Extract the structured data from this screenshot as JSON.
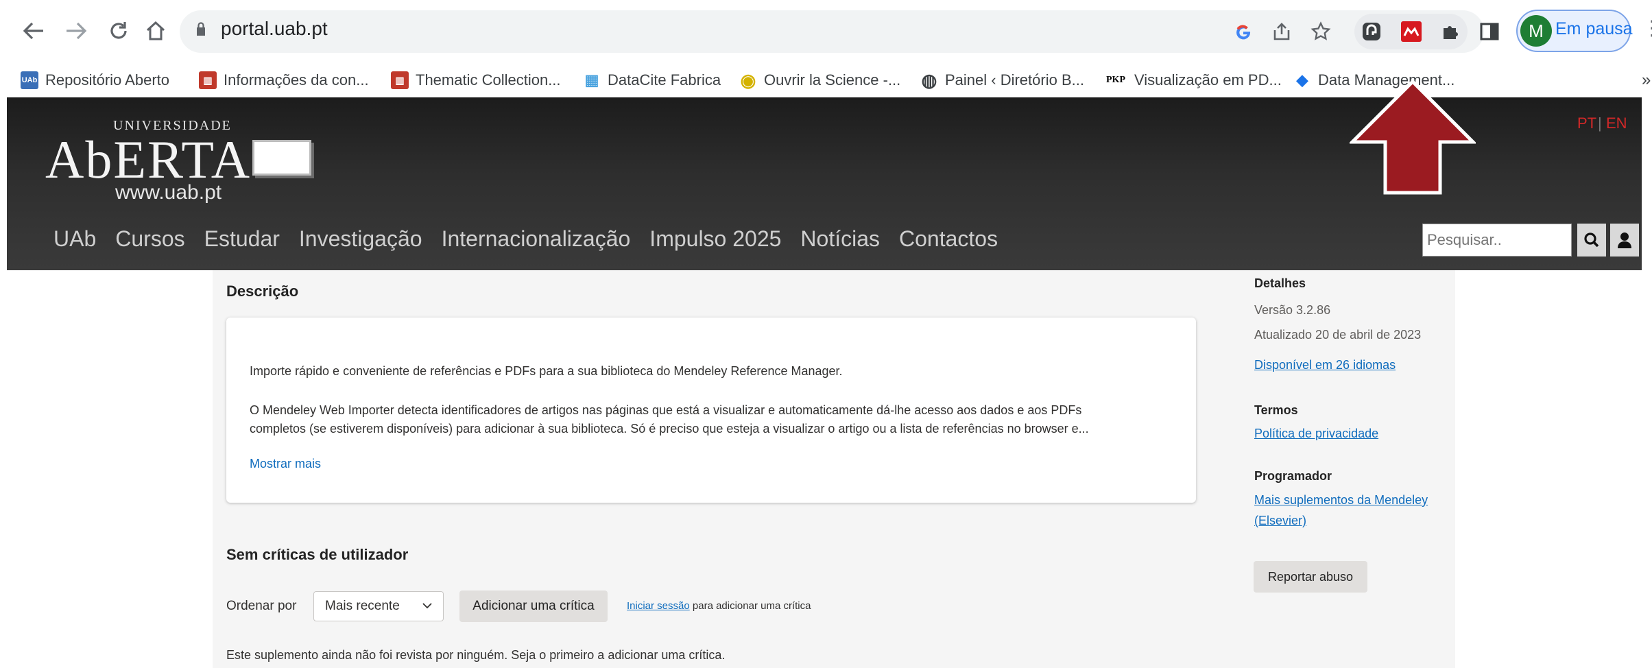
{
  "browser": {
    "url": "portal.uab.pt",
    "profile_initial": "M",
    "profile_label": "Em pausa",
    "nav_icons": [
      "back-icon",
      "forward-icon",
      "reload-icon",
      "home-icon"
    ],
    "omnibox_icons": [
      "google-icon",
      "share-icon",
      "star-icon"
    ],
    "extension_icons": [
      "elephant-extension-icon",
      "mendeley-extension-icon",
      "puzzle-extensions-icon",
      "side-panel-icon"
    ]
  },
  "bookmarks": [
    {
      "label": "Repositório Aberto",
      "icon": "uab-icon",
      "icon_text": "UAb",
      "icon_color": "#3a6fb7"
    },
    {
      "label": "Informações da con...",
      "icon": "book-icon",
      "icon_text": "▥",
      "icon_color": "#c0392b"
    },
    {
      "label": "Thematic Collection...",
      "icon": "book-icon",
      "icon_text": "▥",
      "icon_color": "#c0392b"
    },
    {
      "label": "DataCite Fabrica",
      "icon": "chart-icon",
      "icon_text": "▦",
      "icon_color": "#4aa3df"
    },
    {
      "label": "Ouvrir la Science -...",
      "icon": "circle-icon",
      "icon_text": "◉",
      "icon_color": "#d4b200"
    },
    {
      "label": "Painel ‹ Diretório B...",
      "icon": "globe-icon",
      "icon_text": "◍",
      "icon_color": "#3c4043"
    },
    {
      "label": "Visualização em PD...",
      "icon": "pkp-icon",
      "icon_text": "PKP",
      "icon_color": "#ffffff"
    },
    {
      "label": "Data Management...",
      "icon": "diamond-icon",
      "icon_text": "◆",
      "icon_color": "#1a73e8"
    }
  ],
  "bookmarks_overflow": "»",
  "site": {
    "logo_universidade": "UNIVERSIDADE",
    "logo_aberta": "AbERTA",
    "logo_url": "www.uab.pt",
    "lang_pt": "PT",
    "lang_sep": "|",
    "lang_en": "EN",
    "nav": [
      "UAb",
      "Cursos",
      "Estudar",
      "Investigação",
      "Internacionalização",
      "Impulso 2025",
      "Notícias",
      "Contactos"
    ],
    "search_placeholder": "Pesquisar..",
    "colors": {
      "header": "#2e2e2e",
      "lang": "#d22828",
      "arrow": "#9b1b21"
    }
  },
  "store": {
    "description_heading": "Descrição",
    "description_p1": "Importe rápido e conveniente de referências e PDFs para a sua biblioteca do Mendeley Reference Manager.",
    "description_p2_line1": "O Mendeley Web Importer detecta identificadores de artigos nas páginas que está a visualizar e automaticamente dá-lhe acesso aos dados e aos PDFs",
    "description_p2_line2": "completos (se estiverem disponíveis) para adicionar à sua biblioteca. Só é preciso que esteja a visualizar o artigo ou a lista de referências no browser e...",
    "show_more": "Mostrar mais",
    "reviews_heading": "Sem críticas de utilizador",
    "sort_label": "Ordenar por",
    "sort_value": "Mais recente",
    "add_review": "Adicionar uma crítica",
    "sign_in_link": "Iniciar sessão",
    "sign_in_suffix": "para adicionar uma crítica",
    "no_reviews_text": "Este suplemento ainda não foi revista por ninguém. Seja o primeiro a adicionar uma crítica."
  },
  "details": {
    "heading": "Detalhes",
    "version": "Versão 3.2.86",
    "updated": "Atualizado 20 de abril de 2023",
    "languages_link": "Disponível em 26 idiomas",
    "terms_heading": "Termos",
    "privacy_link": "Política de privacidade",
    "developer_heading": "Programador",
    "developer_link_line1": "Mais suplementos da Mendeley",
    "developer_link_line2": "(Elsevier)",
    "report_abuse": "Reportar abuso"
  }
}
